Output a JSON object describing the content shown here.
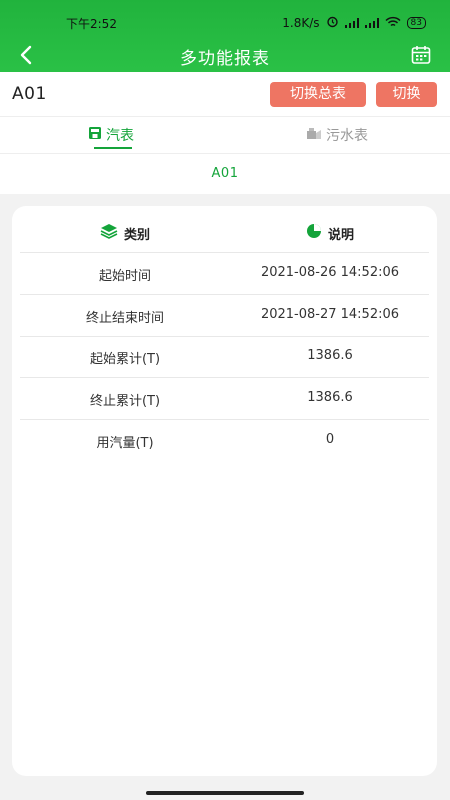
{
  "status_bar": {
    "time": "下午2:52",
    "net_speed": "1.8K/s",
    "battery": "83"
  },
  "header": {
    "title": "多功能报表",
    "back_icon": "back-chevron-icon",
    "calendar_icon": "calendar-icon"
  },
  "toolbar": {
    "device_name": "A01",
    "switch_total_label": "切换总表",
    "switch_label": "切换"
  },
  "tabs": [
    {
      "label": "汽表",
      "icon": "steam-meter-icon",
      "active": true
    },
    {
      "label": "污水表",
      "icon": "sewage-meter-icon",
      "active": false
    }
  ],
  "subtitle": "A01",
  "table": {
    "headers": [
      "类别",
      "说明"
    ],
    "rows": [
      [
        "起始时间",
        "2021-08-26  14:52:06"
      ],
      [
        "终止结束时间",
        "2021-08-27  14:52:06"
      ],
      [
        "起始累计(T)",
        "1386.6"
      ],
      [
        "终止累计(T)",
        "1386.6"
      ],
      [
        "用汽量(T)",
        "0"
      ]
    ]
  },
  "colors": {
    "accent_green": "#21b33d",
    "button_red": "#ee7563",
    "tab_active": "#14a43a"
  }
}
